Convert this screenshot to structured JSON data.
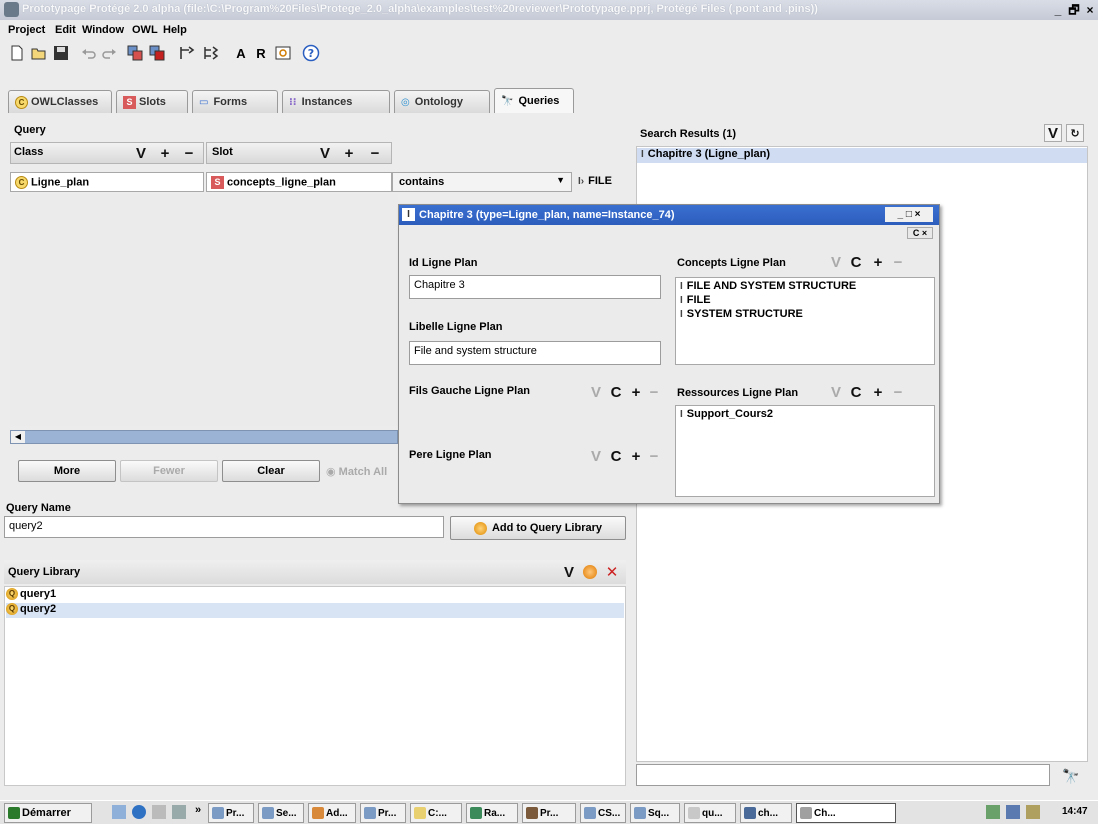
{
  "window": {
    "title": "Prototypage Protégé 2.0 alpha   (file:\\C:\\Program%20Files\\Protege_2.0_alpha\\examples\\test%20reviewer\\Prototypage.pprj, Protégé Files (.pont and .pins))",
    "min": "_",
    "max": "🗗",
    "close": "×"
  },
  "menu": [
    "Project",
    "Edit",
    "Window",
    "OWL",
    "Help"
  ],
  "toolbar": {
    "letters": [
      "A",
      "R"
    ],
    "help": "?"
  },
  "tabs": [
    {
      "label": "OWLClasses",
      "icon": "C"
    },
    {
      "label": "Slots",
      "icon": "S"
    },
    {
      "label": "Forms",
      "icon": "▭"
    },
    {
      "label": "Instances",
      "icon": "⁝⁝"
    },
    {
      "label": "Ontology",
      "icon": "◎"
    },
    {
      "label": "Queries",
      "icon": "🔭"
    }
  ],
  "query": {
    "title": "Query",
    "class_header": "Class",
    "slot_header": "Slot",
    "class_value": "Ligne_plan",
    "slot_value": "concepts_ligne_plan",
    "operator": "contains",
    "value": "FILE",
    "buttons": {
      "more": "More",
      "fewer": "Fewer",
      "clear": "Clear",
      "match": "Match All"
    }
  },
  "query_name": {
    "label": "Query Name",
    "value": "query2",
    "add_button": "Add to Query Library"
  },
  "library": {
    "title": "Query Library",
    "items": [
      "query1",
      "query2"
    ]
  },
  "results": {
    "title": "Search Results (1)",
    "items": [
      "Chapitre 3  (Ligne_plan)"
    ]
  },
  "dialog": {
    "title": "Chapitre 3   (type=Ligne_plan, name=Instance_74)",
    "id_label": "Id Ligne Plan",
    "id_value": "Chapitre 3",
    "libelle_label": "Libelle Ligne Plan",
    "libelle_value": "File and system structure",
    "fils_label": "Fils Gauche Ligne Plan",
    "pere_label": "Pere Ligne Plan",
    "concepts_label": "Concepts Ligne Plan",
    "concepts": [
      "FILE AND SYSTEM STRUCTURE",
      "FILE",
      "SYSTEM STRUCTURE"
    ],
    "ressources_label": "Ressources Ligne Plan",
    "ressources": [
      "Support_Cours2"
    ],
    "btn_v": "V",
    "btn_c": "C",
    "btn_plus": "+",
    "btn_minus": "−"
  },
  "taskbar": {
    "start": "Démarrer",
    "chevron": "»",
    "items": [
      "Pr...",
      "Se...",
      "Ad...",
      "Pr...",
      "C:...",
      "Ra...",
      "Pr...",
      "CS...",
      "Sq...",
      "qu...",
      "ch...",
      "Ch..."
    ],
    "clock": "14:47"
  }
}
